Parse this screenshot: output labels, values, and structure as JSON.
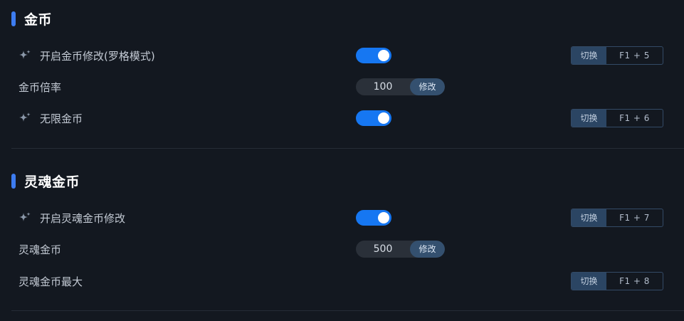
{
  "sections": [
    {
      "title": "金币",
      "rows": [
        {
          "label": "开启金币修改(罗格模式)",
          "icon": "sparkle-icon",
          "toggle_on": true,
          "hotkey": {
            "action": "切换",
            "keys": "F1 + 5"
          }
        },
        {
          "label": "金币倍率",
          "value": "100",
          "button": "修改"
        },
        {
          "label": "无限金币",
          "icon": "sparkle-icon",
          "toggle_on": true,
          "hotkey": {
            "action": "切换",
            "keys": "F1 + 6"
          }
        }
      ]
    },
    {
      "title": "灵魂金币",
      "rows": [
        {
          "label": "开启灵魂金币修改",
          "icon": "sparkle-icon",
          "toggle_on": true,
          "hotkey": {
            "action": "切换",
            "keys": "F1 + 7"
          }
        },
        {
          "label": "灵魂金币",
          "value": "500",
          "button": "修改"
        },
        {
          "label": "灵魂金币最大",
          "hotkey": {
            "action": "切换",
            "keys": "F1 + 8"
          }
        }
      ]
    }
  ],
  "colors": {
    "accent": "#3d7cf0",
    "toggle_on": "#1677f2",
    "background": "#131820"
  }
}
